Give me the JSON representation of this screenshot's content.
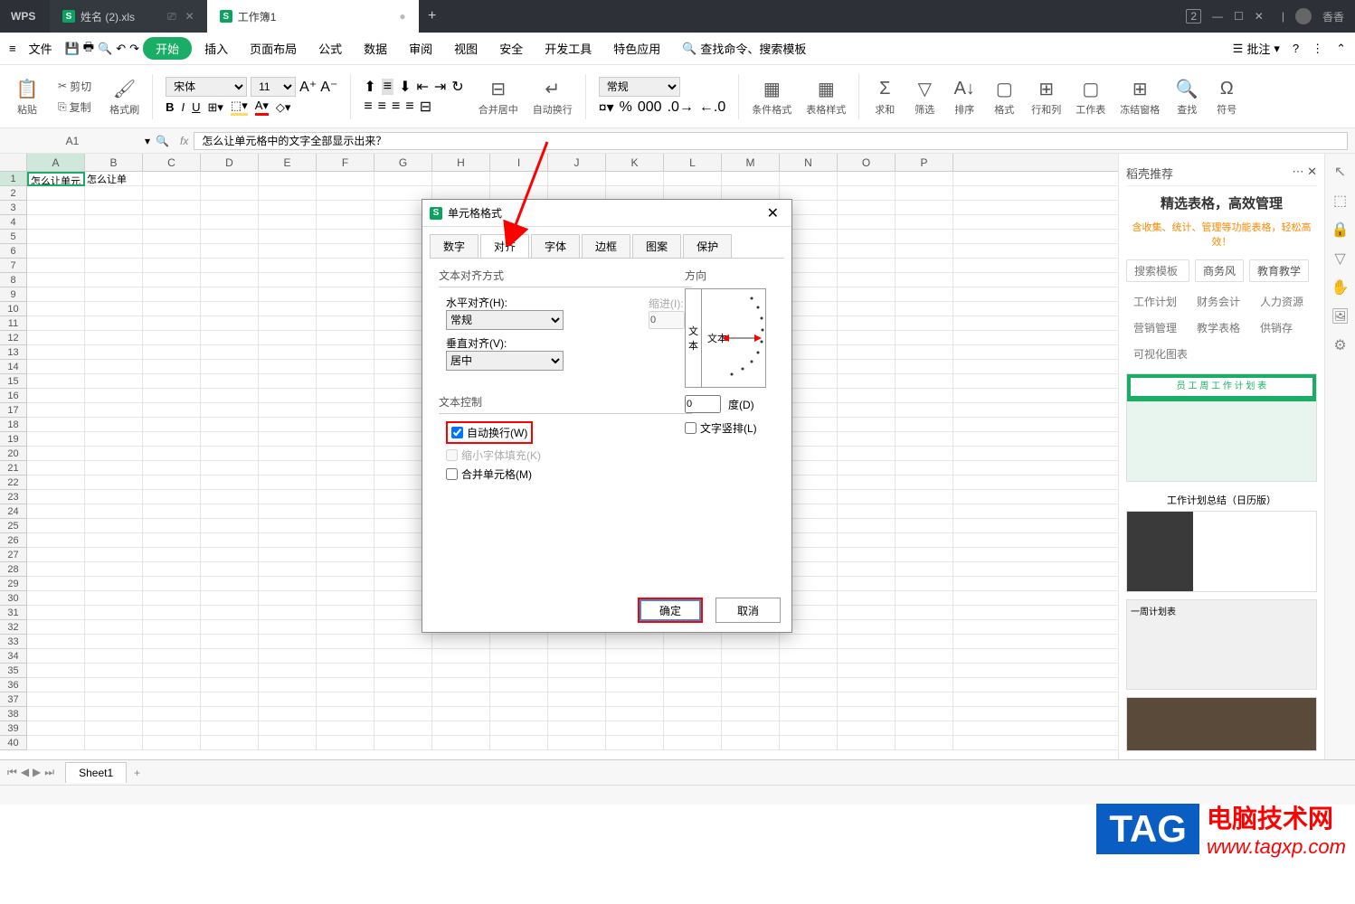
{
  "title": {
    "wps": "WPS",
    "user": "香香"
  },
  "tabs": [
    {
      "label": "姓名 (2).xls"
    },
    {
      "label": "工作簿1"
    }
  ],
  "menu": {
    "file": "文件",
    "start": "开始",
    "insert": "插入",
    "layout": "页面布局",
    "formula": "公式",
    "data": "数据",
    "review": "审阅",
    "view": "视图",
    "safety": "安全",
    "dev": "开发工具",
    "special": "特色应用",
    "search": "查找命令、搜索模板",
    "annot": "批注"
  },
  "toolbar": {
    "paste": "粘贴",
    "cut": "剪切",
    "copy": "复制",
    "fmtbrush": "格式刷",
    "font": "宋体",
    "size": "11",
    "merge": "合并居中",
    "wrap": "自动换行",
    "numfmt": "常规",
    "cond": "条件格式",
    "tblstyle": "表格样式",
    "sum": "求和",
    "filter": "筛选",
    "sort": "排序",
    "format": "格式",
    "rowcol": "行和列",
    "sheet": "工作表",
    "freeze": "冻结窗格",
    "find": "查找",
    "symbol": "符号"
  },
  "ref": {
    "cell": "A1",
    "formula": "怎么让单元格中的文字全部显示出来？",
    "a1text": "怎么让单元",
    "b1text": "怎么让单"
  },
  "cols": [
    "A",
    "B",
    "C",
    "D",
    "E",
    "F",
    "G",
    "H",
    "I",
    "J",
    "K",
    "L",
    "M",
    "N",
    "O",
    "P"
  ],
  "panel": {
    "title": "稻壳推荐",
    "hero": "精选表格，高效管理",
    "sub": "含收集、统计、管理等功能表格，轻松高效！",
    "search_ph": "搜索模板",
    "tags1": [
      "商务风",
      "教育教学"
    ],
    "tags2": [
      "工作计划",
      "财务会计",
      "人力资源",
      "营销管理",
      "教学表格",
      "供销存",
      "可视化图表"
    ],
    "t1": "员 工 周 工 作 计 划 表",
    "t2": "工作计划总结（日历版）",
    "t3": "一周计划表"
  },
  "dialog": {
    "title": "单元格格式",
    "tabs": [
      "数字",
      "对齐",
      "字体",
      "边框",
      "图案",
      "保护"
    ],
    "grp_align": "文本对齐方式",
    "h_label": "水平对齐(H):",
    "h_val": "常规",
    "indent": "缩进(I):",
    "indent_val": "0",
    "v_label": "垂直对齐(V):",
    "v_val": "居中",
    "grp_ctrl": "文本控制",
    "wrap": "自动换行(W)",
    "shrink": "缩小字体填充(K)",
    "mergecell": "合并单元格(M)",
    "grp_dir": "方向",
    "vtext_a": "文",
    "vtext_b": "本",
    "htext": "文本",
    "deg": "度(D)",
    "deg_val": "0",
    "vert": "文字竖排(L)",
    "ok": "确定",
    "cancel": "取消"
  },
  "sheet": {
    "name": "Sheet1"
  },
  "watermark": {
    "tag": "TAG",
    "txt": "电脑技术网",
    "url": "www.tagxp.com"
  }
}
